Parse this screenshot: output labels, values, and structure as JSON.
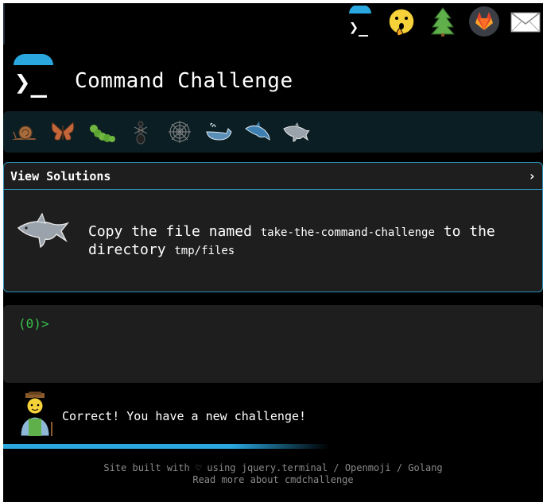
{
  "site": {
    "title": "Command Challenge",
    "logo_glyph": "❯_"
  },
  "topbar": {
    "icons": [
      {
        "name": "cmdchallenge-icon",
        "glyph": "❯_"
      },
      {
        "name": "shushing-face-icon"
      },
      {
        "name": "tree-icon"
      },
      {
        "name": "gitlab-icon"
      },
      {
        "name": "envelope-icon"
      }
    ]
  },
  "challenge_bar": {
    "icons": [
      "snail-icon",
      "butterfly-icon",
      "caterpillar-icon",
      "ant-icon",
      "spider-web-icon",
      "whale-icon",
      "dolphin-blue-icon",
      "dolphin-gray-icon"
    ]
  },
  "card": {
    "header": "View Solutions",
    "chevron": "›",
    "description_pre": "Copy the file named ",
    "code1": "take-the-command-challenge",
    "description_mid": " to the directory ",
    "code2": "tmp/files"
  },
  "terminal": {
    "prompt": "(0)>"
  },
  "feedback": {
    "message": "Correct! You have a new challenge!"
  },
  "progress": {
    "fraction": 0.6
  },
  "footer": {
    "line1_pre": "Site built with ",
    "heart": "♡",
    "line1_mid": " using ",
    "link_jquery": "jquery.terminal",
    "sep": " / ",
    "link_openmoji": "Openmoji",
    "link_golang": "Golang",
    "line2": "Read more about cmdchallenge"
  },
  "colors": {
    "accent": "#2aa7df",
    "prompt_green": "#39c24a",
    "card_border": "#2b8fb8"
  }
}
